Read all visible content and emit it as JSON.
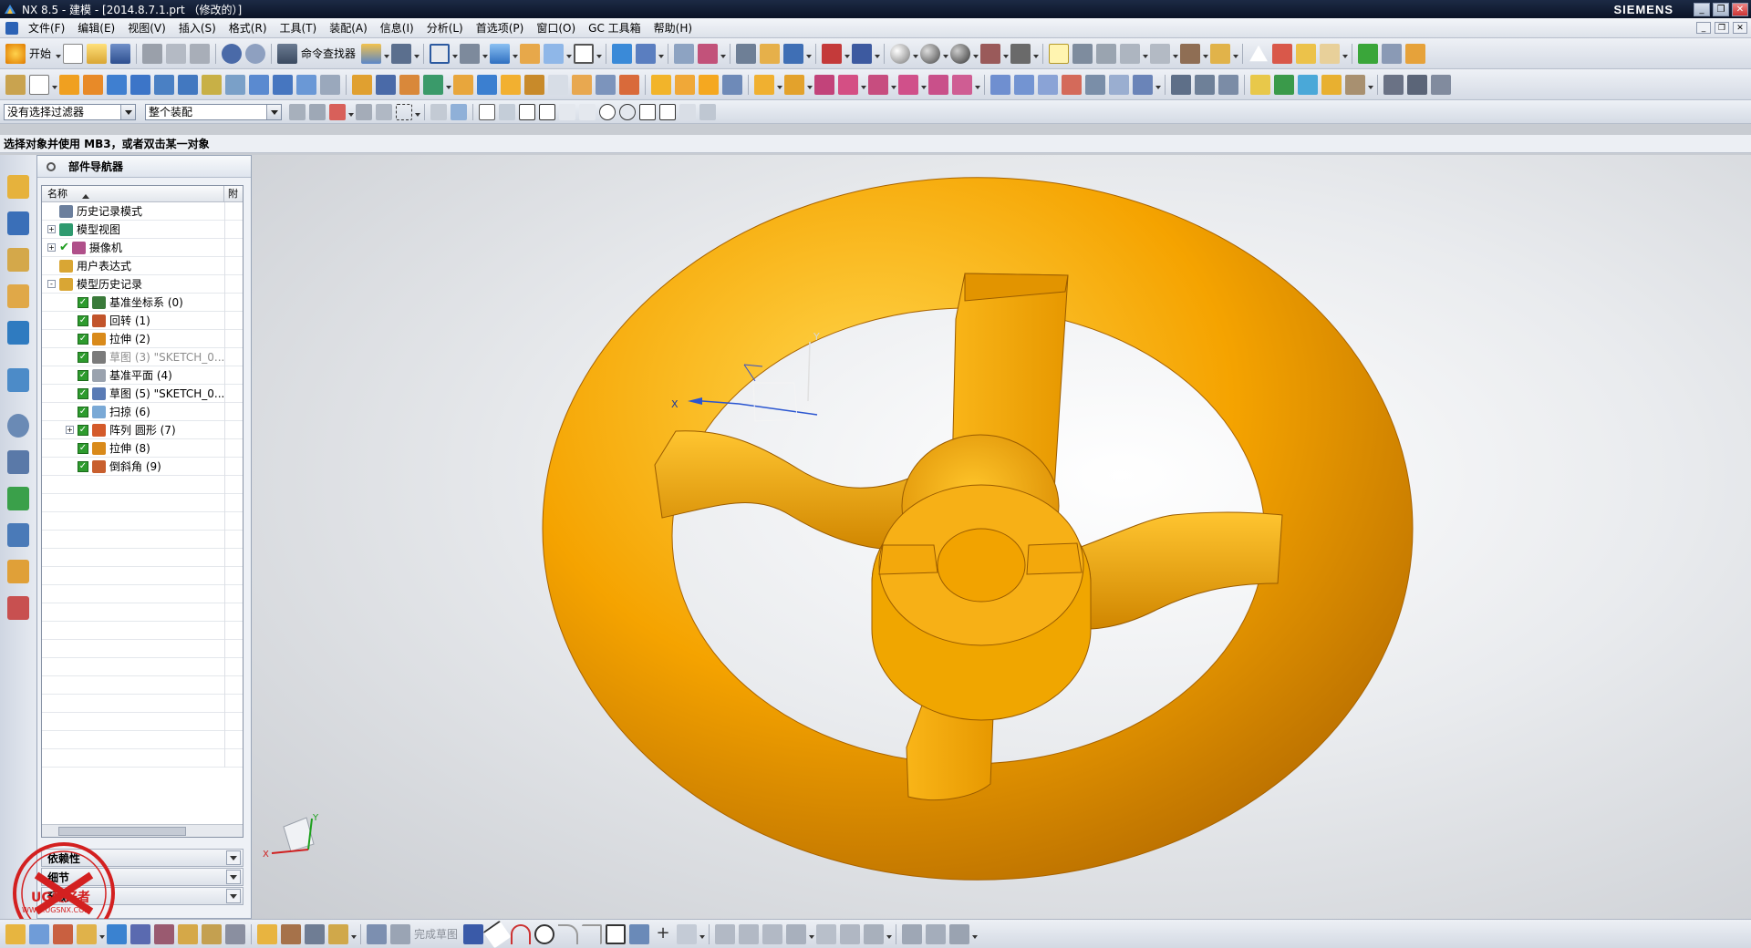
{
  "window": {
    "title": "NX 8.5 - 建模 - [2014.8.7.1.prt （修改的）]",
    "brand": "SIEMENS",
    "controls": [
      "_",
      "❐",
      "✕"
    ]
  },
  "menubar": {
    "items": [
      "文件(F)",
      "编辑(E)",
      "视图(V)",
      "插入(S)",
      "格式(R)",
      "工具(T)",
      "装配(A)",
      "信息(I)",
      "分析(L)",
      "首选项(P)",
      "窗口(O)",
      "GC 工具箱",
      "帮助(H)"
    ]
  },
  "toolbar": {
    "start_label": "开始",
    "command_finder_label": "命令查找器"
  },
  "selection_bar": {
    "filter_value": "没有选择过滤器",
    "scope_value": "整个装配"
  },
  "status": {
    "prompt": "选择对象并使用 MB3，或者双击某一对象"
  },
  "part_navigator": {
    "title": "部件导航器",
    "col_name": "名称",
    "col_attached": "附",
    "items": [
      {
        "label": "历史记录模式",
        "indent": 0,
        "expander": "",
        "check": "",
        "color": "#6b7f9d"
      },
      {
        "label": "模型视图",
        "indent": 0,
        "expander": "+",
        "check": "",
        "color": "#2f9a6f"
      },
      {
        "label": "摄像机",
        "indent": 0,
        "expander": "+",
        "check": "tick",
        "color": "#b0508a"
      },
      {
        "label": "用户表达式",
        "indent": 0,
        "expander": "",
        "check": "",
        "color": "#d9a634"
      },
      {
        "label": "模型历史记录",
        "indent": 0,
        "expander": "-",
        "check": "",
        "color": "#d9a634"
      },
      {
        "label": "基准坐标系 (0)",
        "indent": 1,
        "expander": "",
        "check": "box",
        "color": "#3a7a3a"
      },
      {
        "label": "回转 (1)",
        "indent": 1,
        "expander": "",
        "check": "box",
        "color": "#c2542b"
      },
      {
        "label": "拉伸 (2)",
        "indent": 1,
        "expander": "",
        "check": "box",
        "color": "#d98a1a"
      },
      {
        "label": "草图 (3) \"SKETCH_0...",
        "indent": 1,
        "expander": "",
        "check": "box",
        "color": "#7b7b7b",
        "grey": true
      },
      {
        "label": "基准平面 (4)",
        "indent": 1,
        "expander": "",
        "check": "box",
        "color": "#9aa2ae"
      },
      {
        "label": "草图 (5) \"SKETCH_0...",
        "indent": 1,
        "expander": "",
        "check": "box",
        "color": "#5a7bb5"
      },
      {
        "label": "扫掠 (6)",
        "indent": 1,
        "expander": "",
        "check": "box",
        "color": "#7aa9d6"
      },
      {
        "label": "阵列 圆形 (7)",
        "indent": 1,
        "expander": "+",
        "check": "box",
        "color": "#d45a2a"
      },
      {
        "label": "拉伸 (8)",
        "indent": 1,
        "expander": "",
        "check": "box",
        "color": "#d98a1a"
      },
      {
        "label": "倒斜角 (9)",
        "indent": 1,
        "expander": "",
        "check": "box",
        "color": "#c85f2e"
      }
    ],
    "panels": [
      "依赖性",
      "细节",
      "预览"
    ]
  },
  "bottom_toolbar": {
    "finish_sketch_label": "完成草图"
  },
  "watermark": {
    "text": "UG爱好者",
    "url": "WWW.UGSNX.COM"
  },
  "triad": {
    "x": "X",
    "y": "Y"
  },
  "model": {
    "color": "#f5a300",
    "shade_dark": "#c77a00",
    "shade_light": "#ffd04a"
  }
}
